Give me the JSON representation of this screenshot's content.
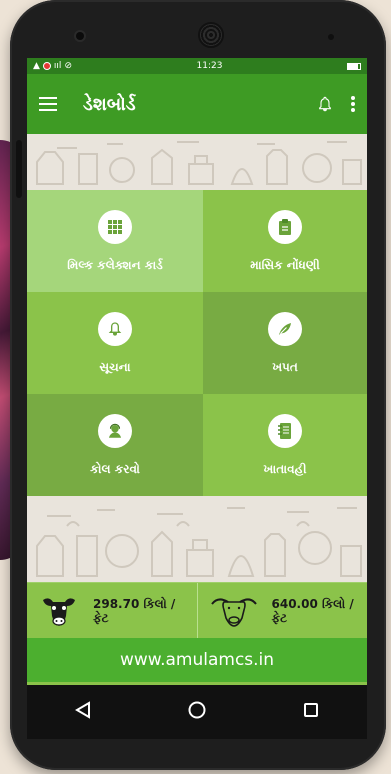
{
  "status_bar": {
    "time": "11:23",
    "signal": "ᯤl",
    "net": "ııl"
  },
  "app_bar": {
    "title": "ડેશબોર્ડ"
  },
  "tiles": [
    {
      "label": "મિલ્ક કલેક્શન કાર્ડ",
      "icon": "grid-icon"
    },
    {
      "label": "માસિક નોંધણી",
      "icon": "clipboard-icon"
    },
    {
      "label": "સૂચના",
      "icon": "bell-icon"
    },
    {
      "label": "ખપત",
      "icon": "leaf-icon"
    },
    {
      "label": "કોલ કરવો",
      "icon": "support-agent-icon"
    },
    {
      "label": "ખાતાવહી",
      "icon": "ledger-icon"
    }
  ],
  "stats": {
    "cow": {
      "value": "298.70 કિલો /",
      "unit": "ફેટ",
      "icon": "cow-icon"
    },
    "buffalo": {
      "value": "640.00 કિલો /",
      "unit": "ફેટ",
      "icon": "buffalo-icon"
    }
  },
  "footer": {
    "website": "www.amulamcs.in"
  },
  "colors": {
    "appbar": "#3e9b24",
    "tile": "#8bc34a",
    "tile_selected": "#a5d67b",
    "tile_dark": "#78ab43",
    "footer": "#4caf2f"
  }
}
